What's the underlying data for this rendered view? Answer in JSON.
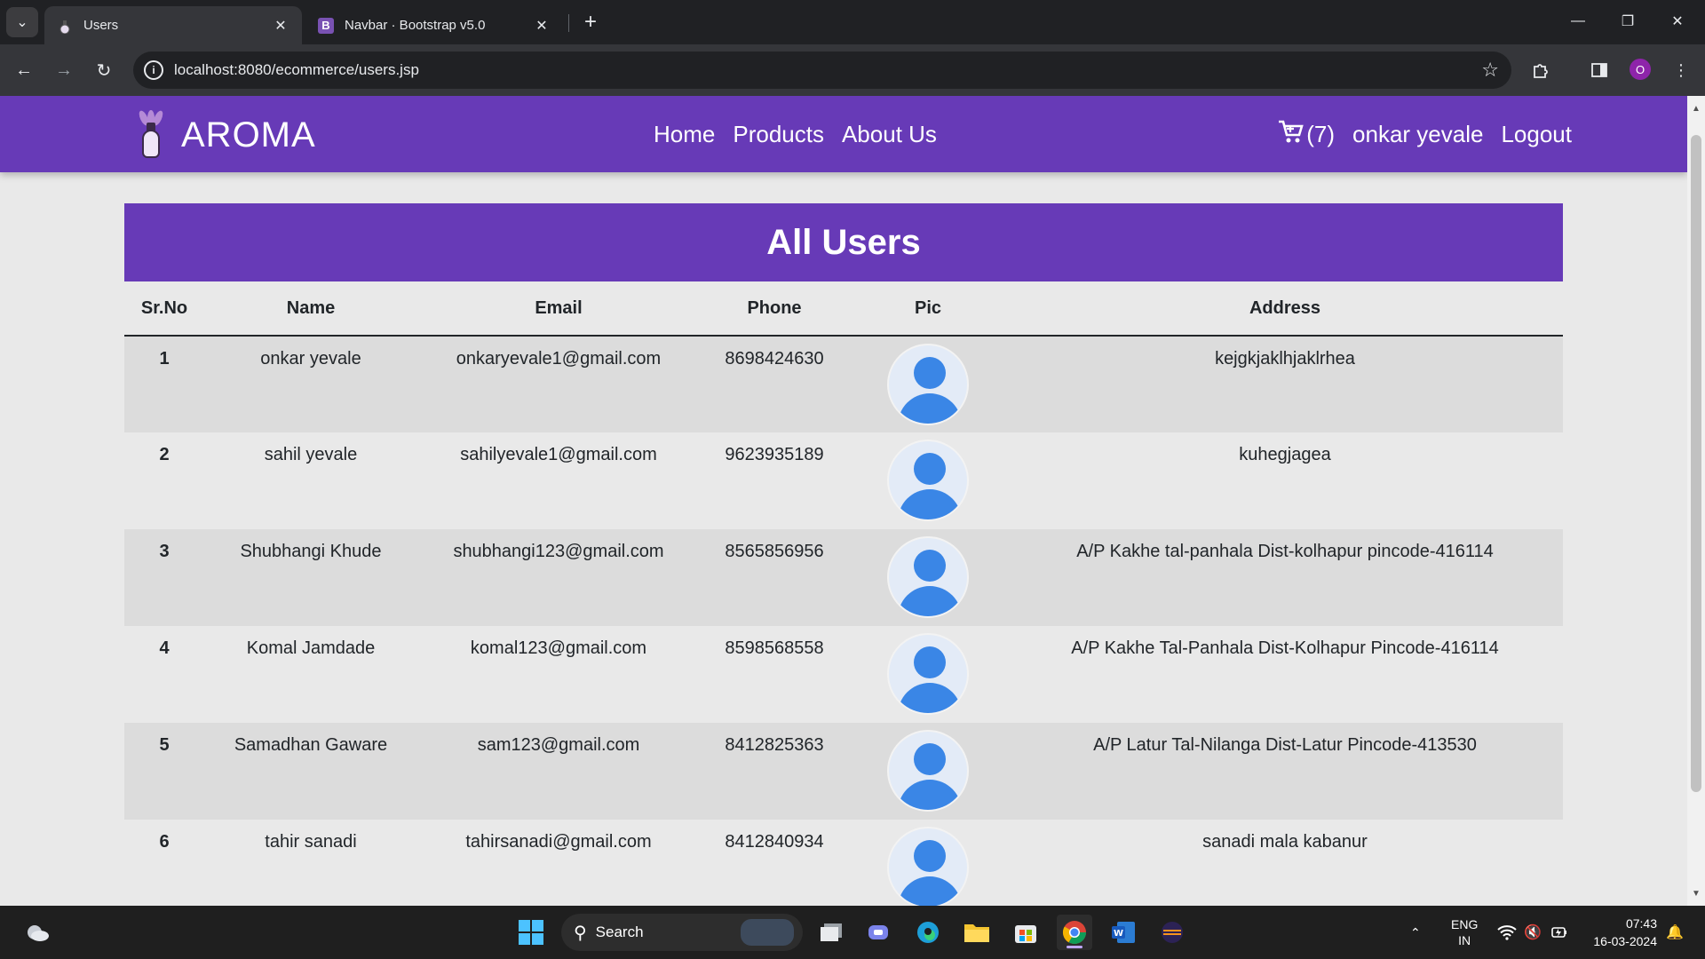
{
  "browser": {
    "tabs": [
      {
        "title": "Users",
        "favicon": "aroma-logo-icon",
        "active": true
      },
      {
        "title": "Navbar · Bootstrap v5.0",
        "favicon": "B",
        "active": false
      }
    ],
    "url": "localhost:8080/ecommerce/users.jsp",
    "profile_initial": "O"
  },
  "site": {
    "brand": "AROMA",
    "nav_links": [
      "Home",
      "Products",
      "About Us"
    ],
    "cart_label": "(7)",
    "user_name": "onkar yevale",
    "logout_label": "Logout",
    "accent_color": "#673ab7"
  },
  "page": {
    "heading": "All Users",
    "columns": [
      "Sr.No",
      "Name",
      "Email",
      "Phone",
      "Pic",
      "Address"
    ],
    "rows": [
      {
        "sr": "1",
        "name": "onkar yevale",
        "email": "onkaryevale1@gmail.com",
        "phone": "8698424630",
        "address": "kejgkjaklhjaklrhea"
      },
      {
        "sr": "2",
        "name": "sahil yevale",
        "email": "sahilyevale1@gmail.com",
        "phone": "9623935189",
        "address": "kuhegjagea"
      },
      {
        "sr": "3",
        "name": "Shubhangi Khude",
        "email": "shubhangi123@gmail.com",
        "phone": "8565856956",
        "address": "A/P Kakhe tal-panhala Dist-kolhapur pincode-416114"
      },
      {
        "sr": "4",
        "name": "Komal Jamdade",
        "email": "komal123@gmail.com",
        "phone": "8598568558",
        "address": "A/P Kakhe Tal-Panhala Dist-Kolhapur Pincode-416114"
      },
      {
        "sr": "5",
        "name": "Samadhan Gaware",
        "email": "sam123@gmail.com",
        "phone": "8412825363",
        "address": "A/P Latur Tal-Nilanga Dist-Latur Pincode-413530"
      },
      {
        "sr": "6",
        "name": "tahir sanadi",
        "email": "tahirsanadi@gmail.com",
        "phone": "8412840934",
        "address": "sanadi mala kabanur"
      }
    ]
  },
  "taskbar": {
    "search_placeholder": "Search",
    "language_line1": "ENG",
    "language_line2": "IN",
    "time": "07:43",
    "date": "16-03-2024"
  }
}
